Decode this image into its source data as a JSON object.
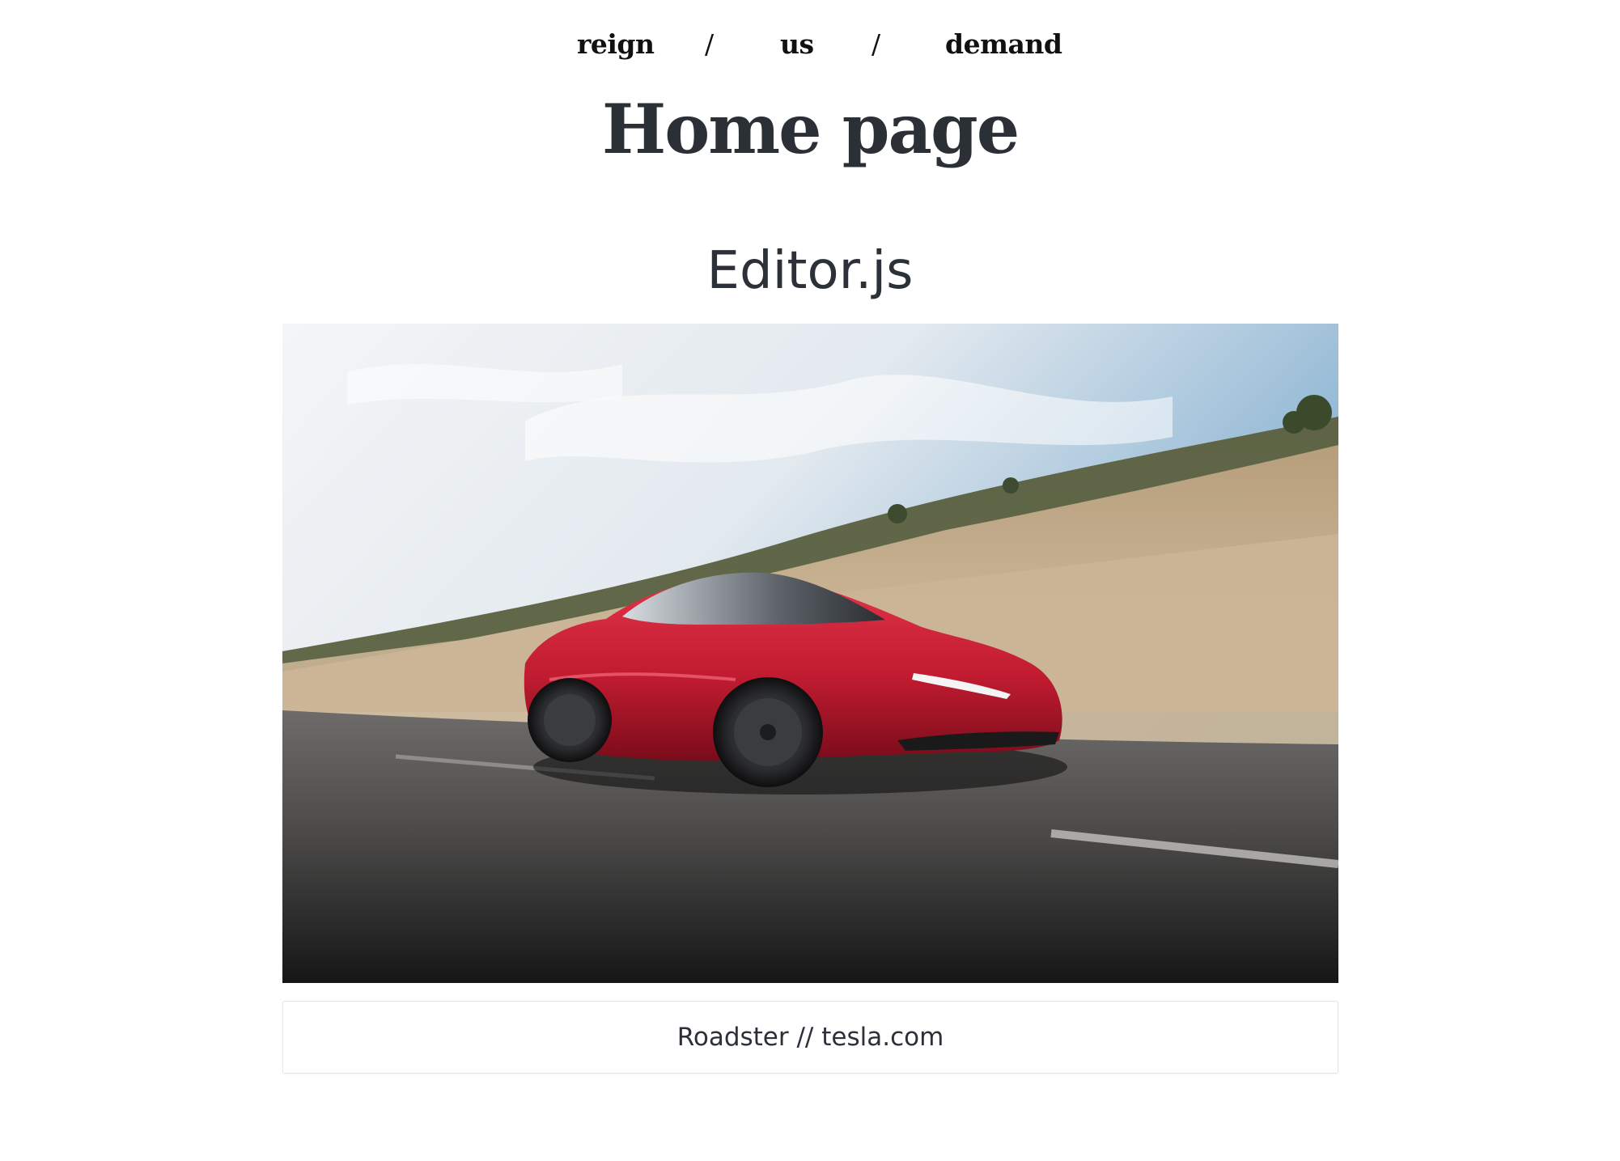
{
  "nav": {
    "items": [
      {
        "label": "reign"
      },
      {
        "label": "us"
      },
      {
        "label": "demand"
      }
    ],
    "separator": "/"
  },
  "page": {
    "title": "Home page"
  },
  "editor": {
    "heading": "Editor.js",
    "image": {
      "caption": "Roadster // tesla.com"
    }
  }
}
